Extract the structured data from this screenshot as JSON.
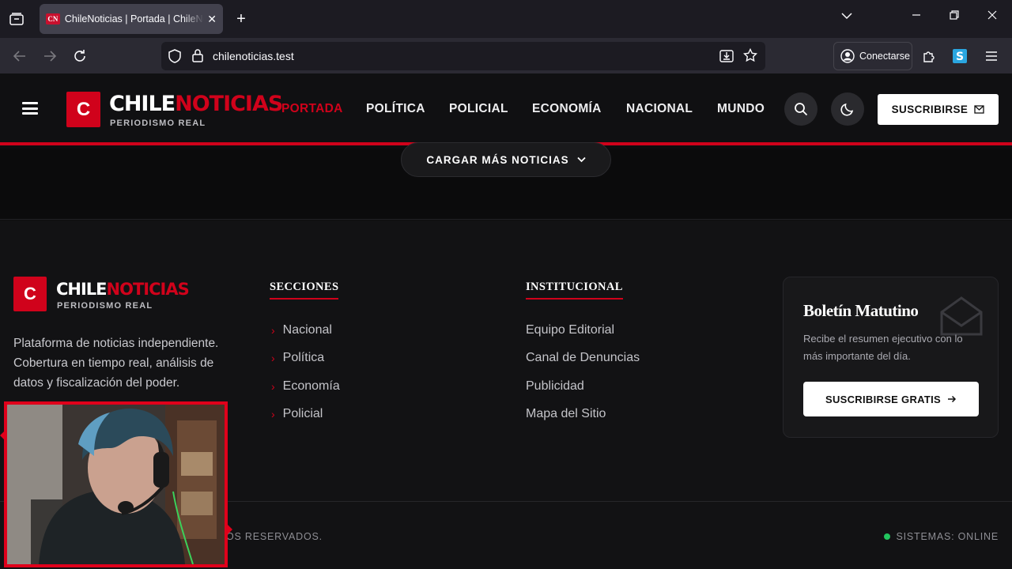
{
  "browser": {
    "tab_title": "ChileNoticias | Portada | ChileNoticias",
    "tab_favicon": "CN",
    "url": "chilenoticias.test",
    "connect_label": "Conectarse"
  },
  "header": {
    "logo_letter": "C",
    "logo_word_1": "CHILE",
    "logo_word_2": "NOTICIAS",
    "logo_tagline": "PERIODISMO REAL",
    "menu": [
      "PORTADA",
      "POLÍTICA",
      "POLICIAL",
      "ECONOMÍA",
      "NACIONAL",
      "MUNDO"
    ],
    "subscribe_label": "SUSCRIBIRSE"
  },
  "main": {
    "load_more_label": "CARGAR MÁS NOTICIAS"
  },
  "footer": {
    "logo_letter": "C",
    "logo_word_1": "CHILE",
    "logo_word_2": "NOTICIAS",
    "logo_tagline": "PERIODISMO REAL",
    "description": "Plataforma de noticias independiente. Cobertura en tiempo real, análisis de datos y fiscalización del poder.",
    "sections_heading": "SECCIONES",
    "sections": [
      "Nacional",
      "Política",
      "Economía",
      "Policial"
    ],
    "institutional_heading": "INSTITUCIONAL",
    "institutional": [
      "Equipo Editorial",
      "Canal de Denuncias",
      "Publicidad",
      "Mapa del Sitio"
    ],
    "newsletter": {
      "title": "Boletín Matutino",
      "description": "Recibe el resumen ejecutivo con lo más importante del día.",
      "button": "SUSCRIBIRSE GRATIS"
    },
    "copyright_visible": "OS RESERVADOS.",
    "status": "SISTEMAS: ONLINE"
  },
  "colors": {
    "brand_red": "#d0021b",
    "status_green": "#22c55e"
  }
}
